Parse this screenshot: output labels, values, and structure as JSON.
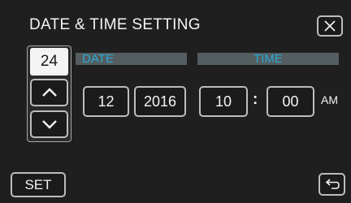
{
  "header": {
    "title": "DATE & TIME SETTING",
    "close_icon": "close-icon"
  },
  "date_section": {
    "label": "DATE",
    "day": "24",
    "month": "12",
    "year": "2016"
  },
  "time_section": {
    "label": "TIME",
    "hour": "10",
    "separator": ":",
    "minute": "00",
    "period": "AM"
  },
  "controls": {
    "up_icon": "chevron-up-icon",
    "down_icon": "chevron-down-icon",
    "set_label": "SET",
    "back_icon": "return-icon"
  },
  "colors": {
    "background": "#1f1f1f",
    "header_bar": "#545d5f",
    "header_text": "#2aa8d4",
    "button_border": "#bdbdbd",
    "selected_bg": "#f4f4f4"
  }
}
